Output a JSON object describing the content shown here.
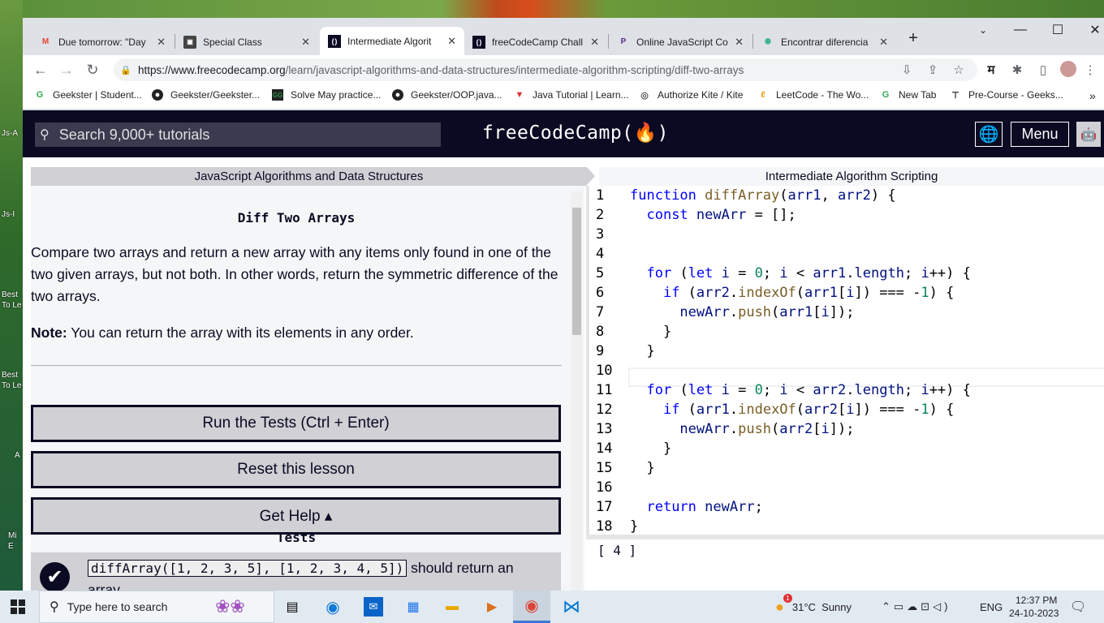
{
  "browser": {
    "tabs": [
      {
        "title": "Due tomorrow: \"Day",
        "icon": "gmail-icon"
      },
      {
        "title": "Special Class",
        "icon": "classroom-icon"
      },
      {
        "title": "Intermediate Algorit",
        "icon": "fcc-icon",
        "active": true
      },
      {
        "title": "freeCodeCamp Chall",
        "icon": "fcc-icon"
      },
      {
        "title": "Online JavaScript Co",
        "icon": "programiz-icon"
      },
      {
        "title": "Encontrar diferencia",
        "icon": "chatgpt-icon"
      }
    ],
    "url_host": "https://www.freecodecamp.org",
    "url_path": "/learn/javascript-algorithms-and-data-structures/intermediate-algorithm-scripting/diff-two-arrays",
    "profile_letter": "म",
    "bookmarks": [
      "Geekster | Student...",
      "Geekster/Geekster...",
      "Solve May practice...",
      "Geekster/OOP.java...",
      "Java Tutorial | Learn...",
      "Authorize Kite / Kite",
      "LeetCode - The Wo...",
      "New Tab",
      "Pre-Course - Geeks..."
    ]
  },
  "desktop_icons": [
    "Js-A",
    "Js-I",
    "Best To Le",
    "Best To Le",
    "A",
    "Mi E"
  ],
  "fcc": {
    "search_placeholder": "Search 9,000+ tutorials",
    "logo": "freeCodeCamp(🔥)",
    "menu_label": "Menu",
    "breadcrumb_left": "JavaScript Algorithms and Data Structures",
    "breadcrumb_right": "Intermediate Algorithm Scripting",
    "challenge_title": "Diff Two Arrays",
    "description": "Compare two arrays and return a new array with any items only found in one of the two given arrays, but not both. In other words, return the symmetric difference of the two arrays.",
    "note_label": "Note:",
    "note_text": " You can return the array with its elements in any order.",
    "run_tests_label": "Run the Tests (Ctrl + Enter)",
    "reset_label": "Reset this lesson",
    "help_label": "Get Help ▴",
    "tests_heading": "Tests",
    "test1_code": "diffArray([1, 2, 3, 5], [1, 2, 3, 4, 5])",
    "test1_text": " should return an array.",
    "console_output": "[ 4 ]",
    "code_lines": [
      "function diffArray(arr1, arr2) {",
      "  const newArr = [];",
      "",
      "",
      "  for (let i = 0; i < arr1.length; i++) {",
      "    if (arr2.indexOf(arr1[i]) === -1) {",
      "      newArr.push(arr1[i]);",
      "    }",
      "  }",
      "",
      "  for (let i = 0; i < arr2.length; i++) {",
      "    if (arr1.indexOf(arr2[i]) === -1) {",
      "      newArr.push(arr2[i]);",
      "    }",
      "  }",
      "",
      "  return newArr;",
      "}"
    ]
  },
  "taskbar": {
    "search_placeholder": "Type here to search",
    "weather": "31°C  Sunny",
    "language": "ENG",
    "time": "12:37 PM",
    "date": "24-10-2023",
    "weather_badge": "1"
  }
}
